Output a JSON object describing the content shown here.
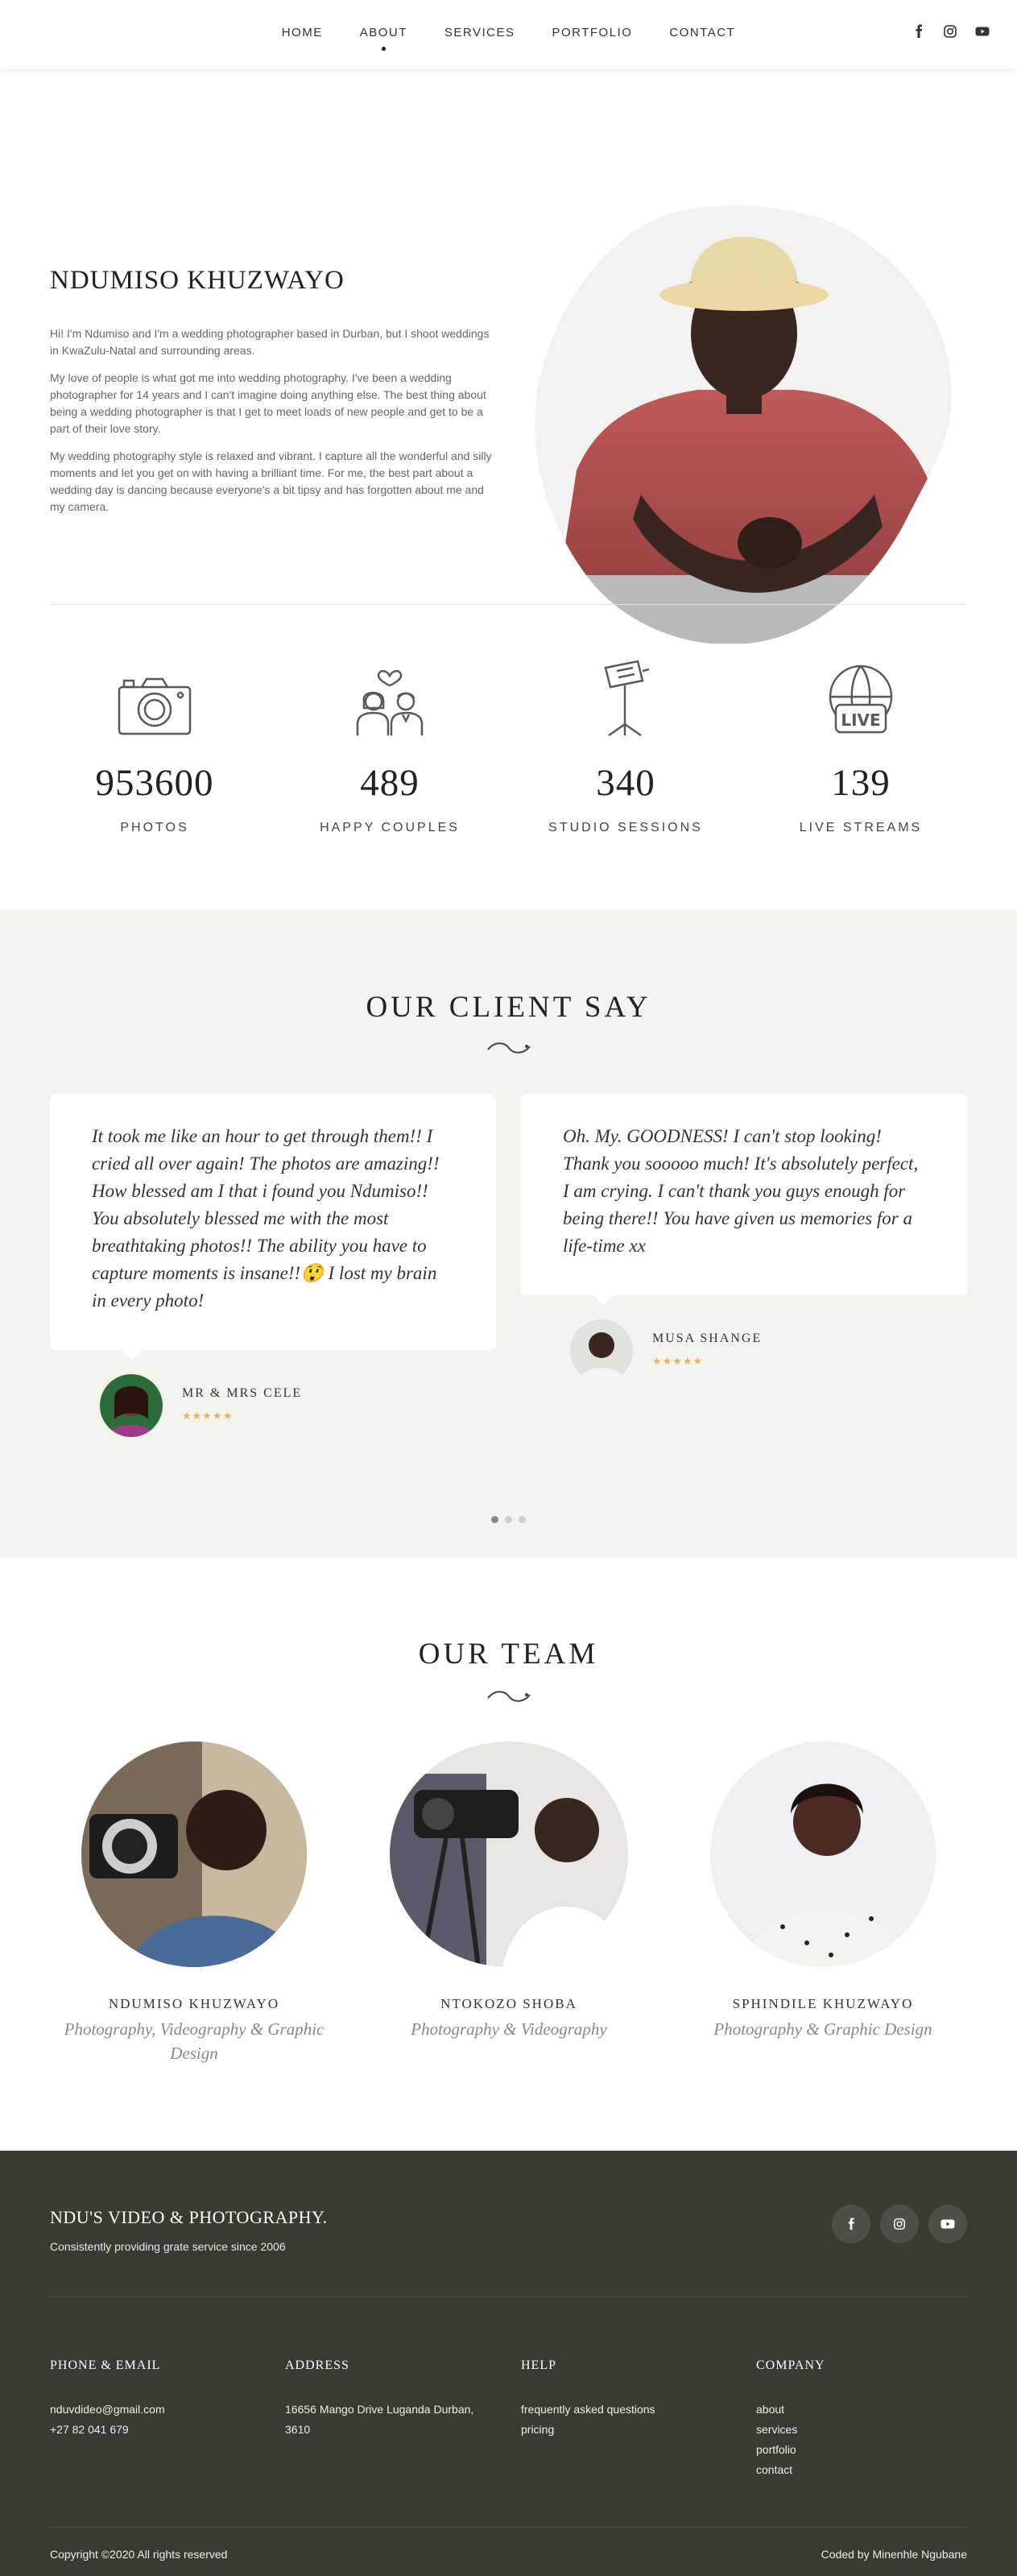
{
  "nav": {
    "links": [
      {
        "label": "HOME"
      },
      {
        "label": "ABOUT"
      },
      {
        "label": "SERVICES"
      },
      {
        "label": "PORTFOLIO"
      },
      {
        "label": "CONTACT"
      }
    ],
    "active": "ABOUT",
    "social_icons": [
      "facebook-icon",
      "instagram-icon",
      "youtube-icon"
    ]
  },
  "about": {
    "title": "NDUMISO KHUZWAYO",
    "paragraphs": [
      "Hi! I'm Ndumiso and I'm a wedding photographer based in Durban, but I shoot weddings in KwaZulu-Natal and surrounding areas.",
      "My love of people is what got me into wedding photography. I've been a wedding photographer for 14 years and I can't imagine doing anything else. The best thing about being a wedding photographer is that I get to meet loads of new people and get to be a part of their love story.",
      "My wedding photography style is relaxed and vibrant. I capture all the wonderful and silly moments and let you get on with having a brilliant time. For me, the best part about a wedding day is dancing because everyone's a bit tipsy and has forgotten about me and my camera."
    ]
  },
  "stats": [
    {
      "icon": "camera-icon",
      "value": "953600",
      "label": "PHOTOS"
    },
    {
      "icon": "couple-icon",
      "value": "489",
      "label": "HAPPY COUPLES"
    },
    {
      "icon": "studio-light-icon",
      "value": "340",
      "label": "STUDIO SESSIONS"
    },
    {
      "icon": "live-stream-icon",
      "value": "139",
      "label": "LIVE STREAMS"
    }
  ],
  "testimonials": {
    "title": "OUR CLIENT SAY",
    "items": [
      {
        "quote": "It took me like an hour to get through them!! I cried all over again! The photos are amazing!! How blessed am I that i found you Ndumiso!! You absolutely blessed me with the most breathtaking photos!! The ability you have to capture moments is insane!!😲 I lost my brain in every photo!",
        "name": "MR & MRS CELE",
        "stars": "★★★★★"
      },
      {
        "quote": "Oh. My. GOODNESS! I can't stop looking! Thank you sooooo much! It's absolutely perfect, I am crying. I can't thank you guys enough for being there!! You have given us memories for a life-time xx",
        "name": "MUSA SHANGE",
        "stars": "★★★★★"
      }
    ],
    "pages": 3,
    "active_page": 1
  },
  "team": {
    "title": "OUR TEAM",
    "members": [
      {
        "name": "NDUMISO KHUZWAYO",
        "role": "Photography, Videography & Graphic Design"
      },
      {
        "name": "NTOKOZO SHOBA",
        "role": "Photography & Videography"
      },
      {
        "name": "SPHINDILE KHUZWAYO",
        "role": "Photography & Graphic Design"
      }
    ]
  },
  "footer": {
    "brand": "NDU'S VIDEO & PHOTOGRAPHY.",
    "tagline": "Consistently providing grate service since 2006",
    "social_icons": [
      "facebook-icon",
      "instagram-icon",
      "youtube-icon"
    ],
    "columns": [
      {
        "title": "PHONE & EMAIL",
        "items": [
          "nduvdideo@gmail.com",
          "+27 82 041 679"
        ]
      },
      {
        "title": "ADDRESS",
        "items": [
          "16656 Mango Drive Luganda Durban,",
          "3610"
        ]
      },
      {
        "title": "HELP",
        "items": [
          "frequently asked questions",
          "pricing"
        ]
      },
      {
        "title": "COMPANY",
        "items": [
          "about",
          "services",
          "portfolio",
          "contact"
        ]
      }
    ],
    "copyright": "Copyright ©2020 All rights reserved",
    "credit": "Coded by Minenhle Ngubane"
  },
  "colors": {
    "footer_bg": "#393b32",
    "testimonial_bg": "#f4f4ef",
    "star_color": "#e2b36b",
    "icon_stroke": "#5a5a52"
  }
}
